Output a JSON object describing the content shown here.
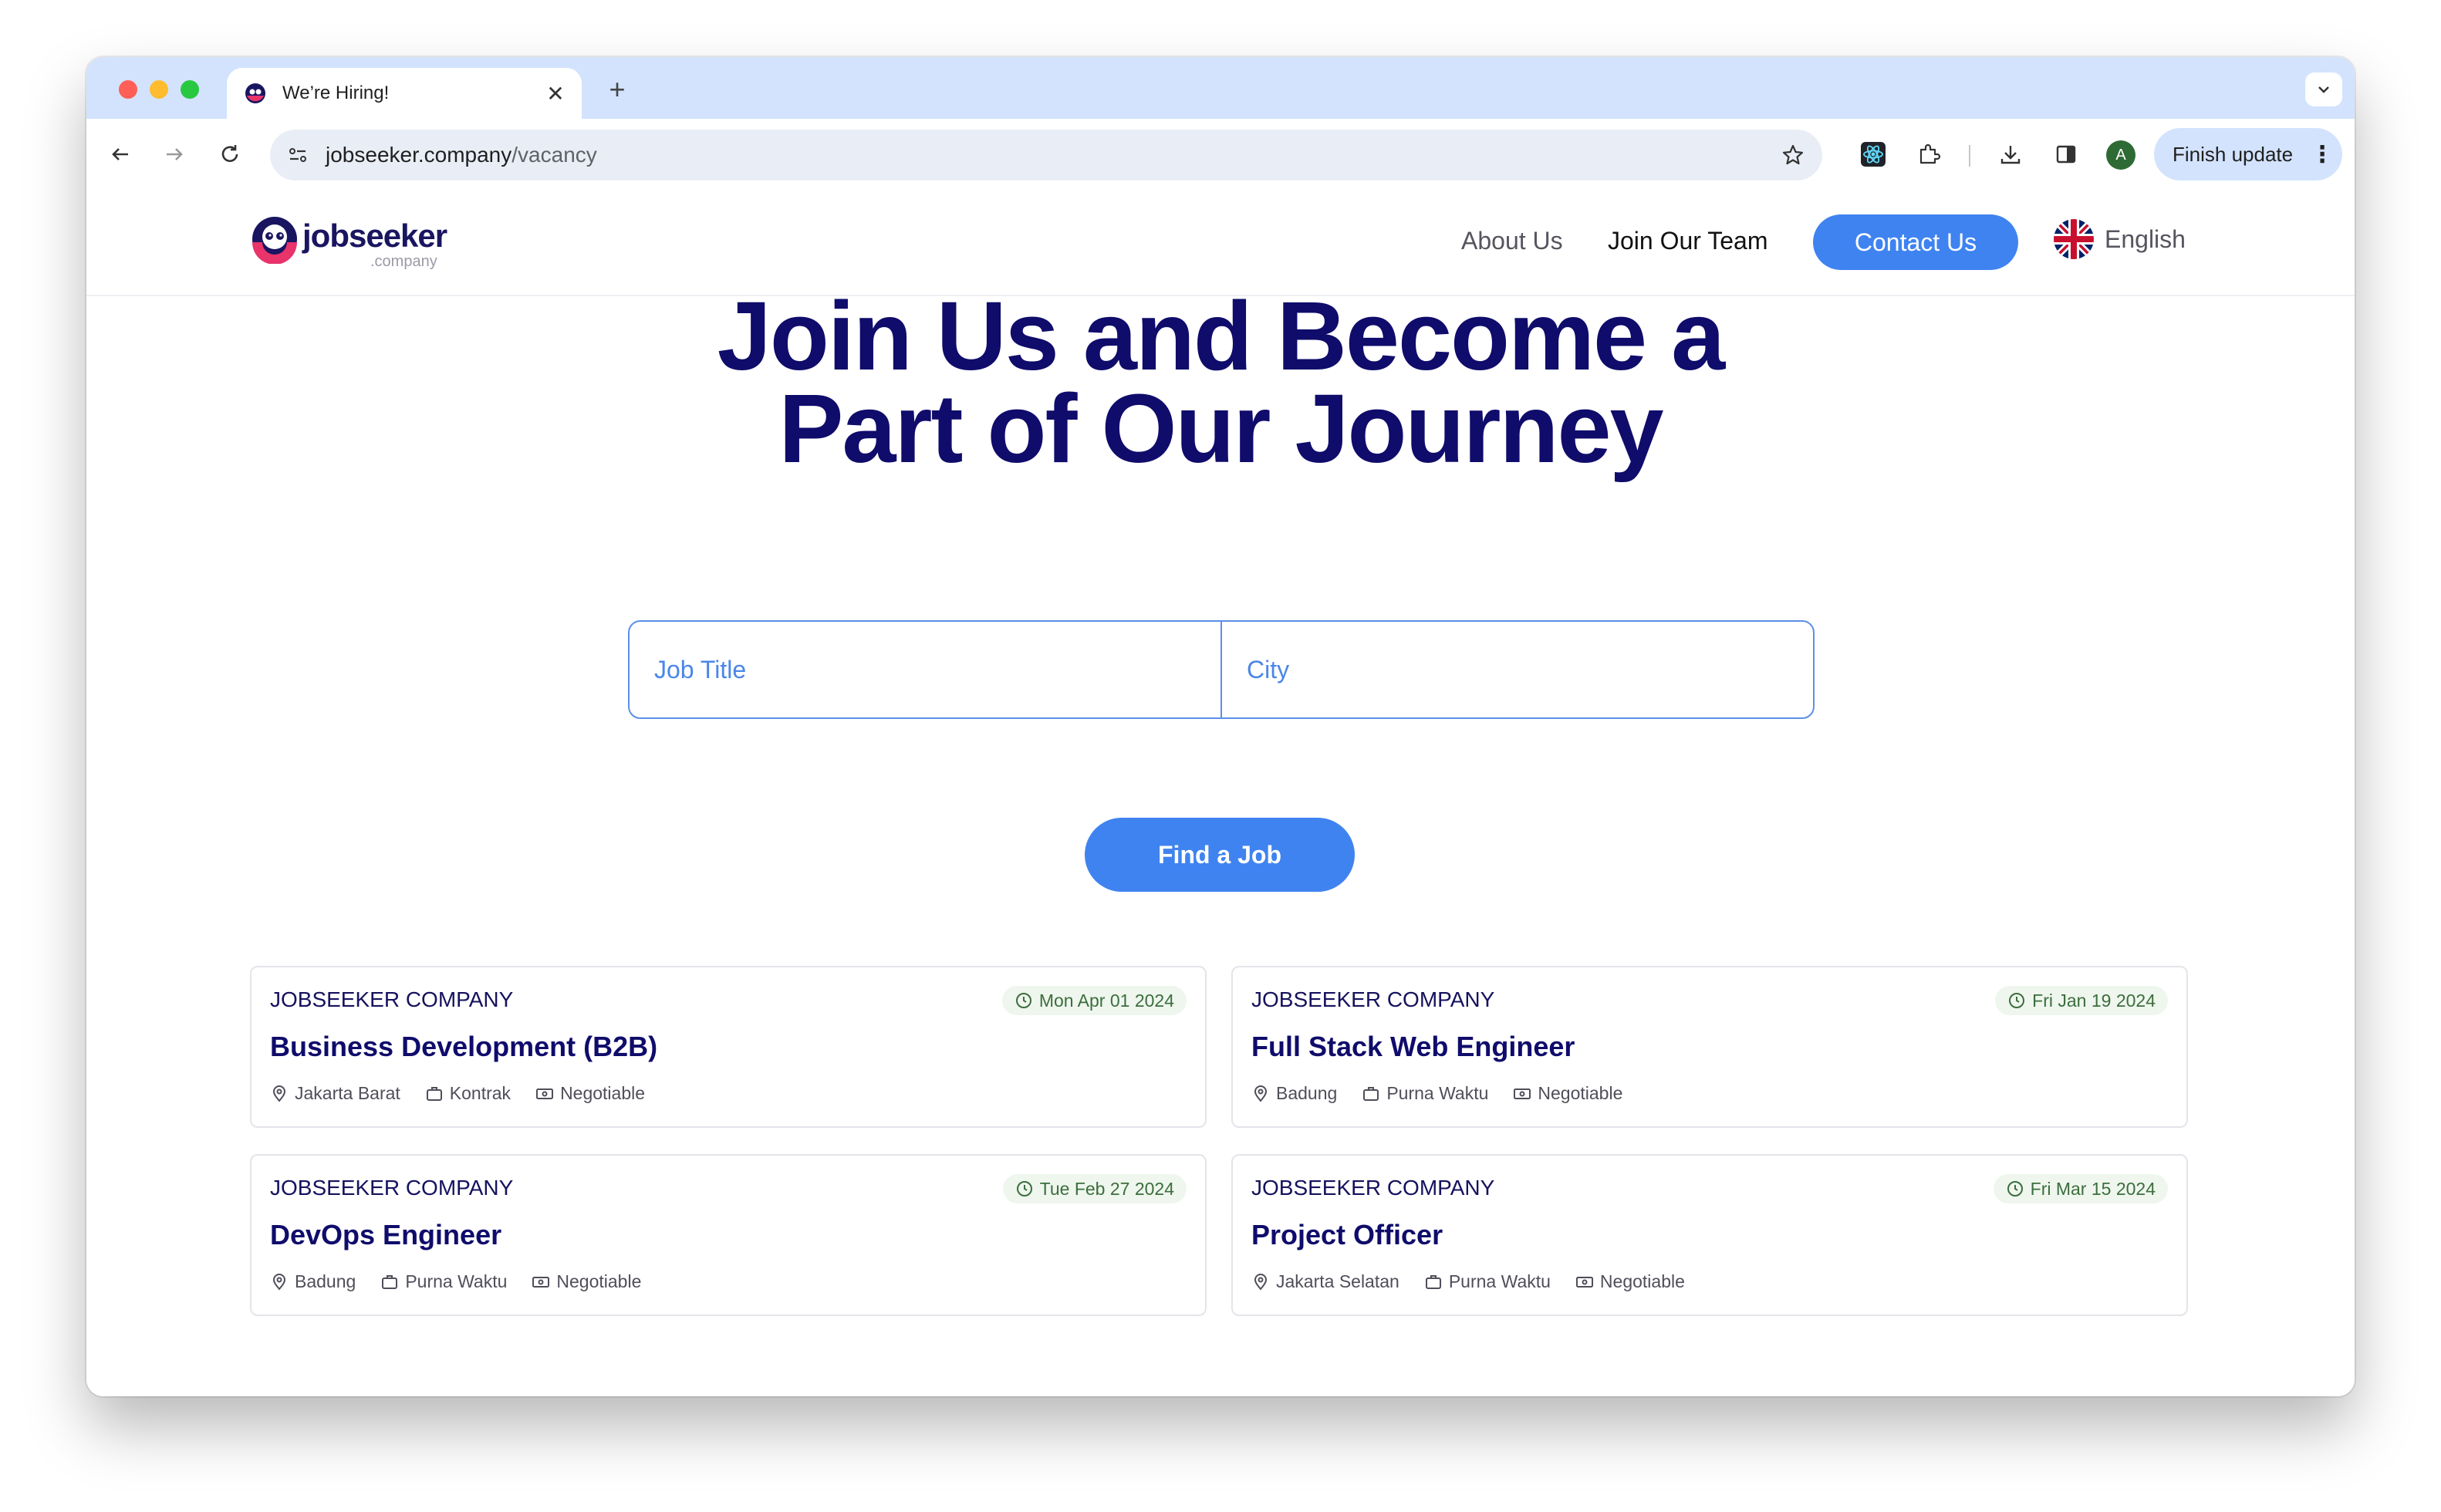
{
  "browser": {
    "tab_title": "We’re Hiring!",
    "url_host": "jobseeker.company",
    "url_path": "/vacancy",
    "avatar_letter": "A",
    "finish_update_label": "Finish update"
  },
  "site": {
    "logo_text": "jobseeker",
    "logo_sub": ".company",
    "nav": {
      "about": "About Us",
      "join": "Join Our Team",
      "contact": "Contact Us",
      "language": "English"
    }
  },
  "hero": {
    "title_line1": "Join Us and Become a",
    "title_line2": "Part of Our Journey"
  },
  "search": {
    "job_title_placeholder": "Job Title",
    "city_placeholder": "City",
    "button_label": "Find a Job"
  },
  "jobs": [
    {
      "company": "JOBSEEKER COMPANY",
      "date": "Mon Apr 01 2024",
      "title": "Business Development (B2B)",
      "location": "Jakarta Barat",
      "type": "Kontrak",
      "salary": "Negotiable"
    },
    {
      "company": "JOBSEEKER COMPANY",
      "date": "Fri Jan 19 2024",
      "title": "Full Stack Web Engineer",
      "location": "Badung",
      "type": "Purna Waktu",
      "salary": "Negotiable"
    },
    {
      "company": "JOBSEEKER COMPANY",
      "date": "Tue Feb 27 2024",
      "title": "DevOps Engineer",
      "location": "Badung",
      "type": "Purna Waktu",
      "salary": "Negotiable"
    },
    {
      "company": "JOBSEEKER COMPANY",
      "date": "Fri Mar 15 2024",
      "title": "Project Officer",
      "location": "Jakarta Selatan",
      "type": "Purna Waktu",
      "salary": "Negotiable"
    }
  ],
  "icons": {
    "date": "clock-icon",
    "location": "map-pin-icon",
    "type": "briefcase-icon",
    "salary": "banknote-icon"
  },
  "colors": {
    "brand_navy": "#0f0c6b",
    "accent_blue": "#3f83f0",
    "date_badge_bg": "#eef6ee",
    "date_badge_text": "#3c6e3c"
  }
}
